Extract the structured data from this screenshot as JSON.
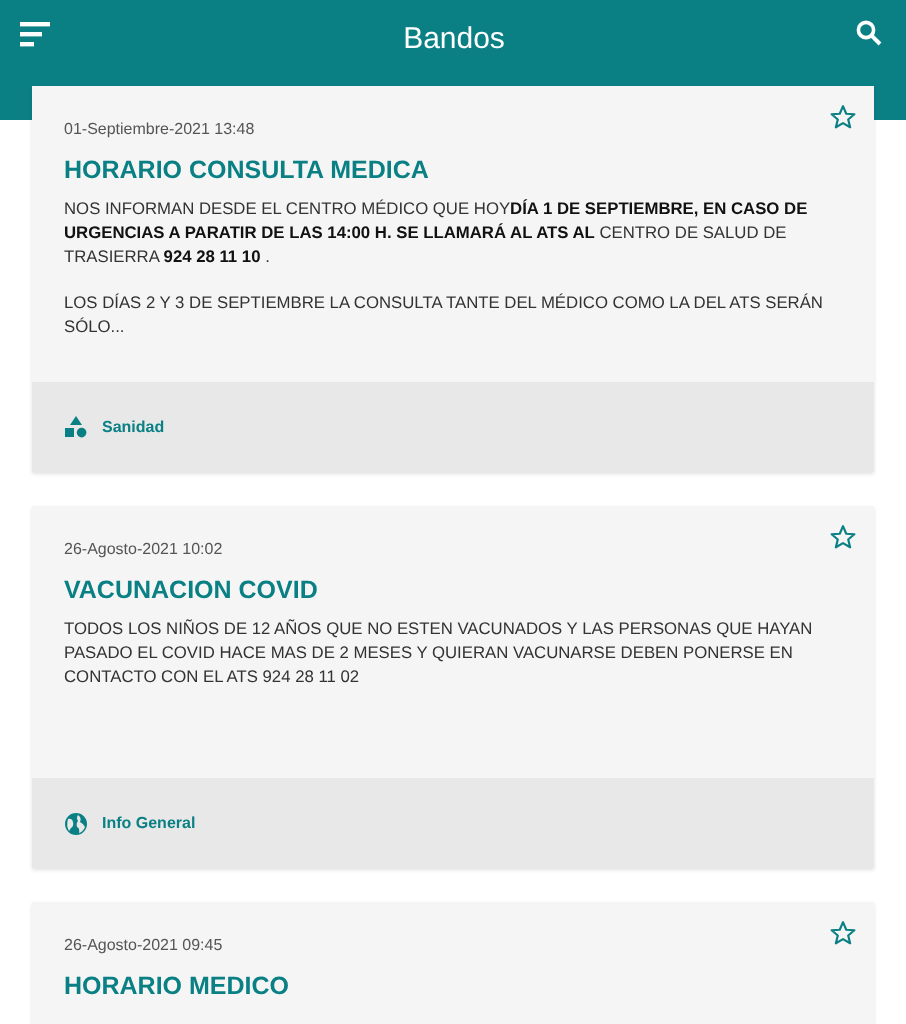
{
  "app_bar": {
    "title": "Bandos"
  },
  "posts": [
    {
      "date": "01-Septiembre-2021 13:48",
      "title": "HORARIO CONSULTA MEDICA",
      "starred": false,
      "paragraphs": [
        "NOS INFORMAN DESDE EL CENTRO MÉDICO QUE HOY**DÍA 1 DE SEPTIEMBRE, EN CASO DE URGENCIAS  A PARATIR DE LAS 14:00 H. SE LLAMARÁ AL ATS AL** CENTRO DE SALUD DE TRASIERRA  **924 28 11 10** .",
        "LOS DÍAS 2 Y 3 DE SEPTIEMBRE LA CONSULTA TANTE DEL MÉDICO COMO LA DEL ATS SERÁN SÓLO..."
      ],
      "category": {
        "kind": "shapes",
        "label": "Sanidad"
      }
    },
    {
      "date": "26-Agosto-2021 10:02",
      "title": "VACUNACION COVID",
      "starred": false,
      "paragraphs": [
        "TODOS LOS NIÑOS DE 12 AÑOS QUE NO ESTEN VACUNADOS Y LAS PERSONAS QUE HAYAN PASADO EL COVID HACE MAS DE 2 MESES Y QUIERAN VACUNARSE DEBEN PONERSE EN CONTACTO CON EL ATS 924 28 11 02"
      ],
      "category": {
        "kind": "globe",
        "label": "Info General"
      }
    },
    {
      "date": "26-Agosto-2021 09:45",
      "title": "HORARIO MEDICO",
      "starred": false
    }
  ]
}
